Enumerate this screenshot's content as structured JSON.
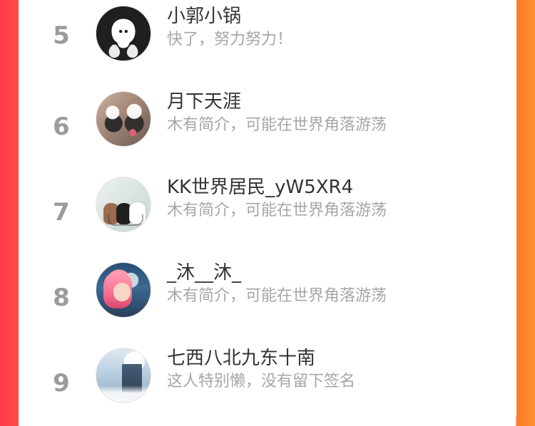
{
  "list": [
    {
      "rank": "5",
      "name": "小郭小锅",
      "desc": "快了，努力努力！",
      "avatar_icon": "ghost-avatar"
    },
    {
      "rank": "6",
      "name": "月下天涯",
      "desc": "木有简介，可能在世界角落游荡",
      "avatar_icon": "dogs-avatar"
    },
    {
      "rank": "7",
      "name": "KK世界居民_yW5XR4",
      "desc": "木有简介，可能在世界角落游荡",
      "avatar_icon": "bears-avatar"
    },
    {
      "rank": "8",
      "name": "_沐__沐_",
      "desc": "木有简介，可能在世界角落游荡",
      "avatar_icon": "anime-avatar"
    },
    {
      "rank": "9",
      "name": "七西八北九东十南",
      "desc": "这人特别懒，没有留下签名",
      "avatar_icon": "winter-avatar"
    }
  ],
  "colors": {
    "left_edge": "#ff3b47",
    "right_edge": "#ff7a2a",
    "rank_text": "#9b9b9b",
    "name_text": "#333333",
    "desc_text": "#a6a6a6",
    "card_bg": "#ffffff"
  }
}
